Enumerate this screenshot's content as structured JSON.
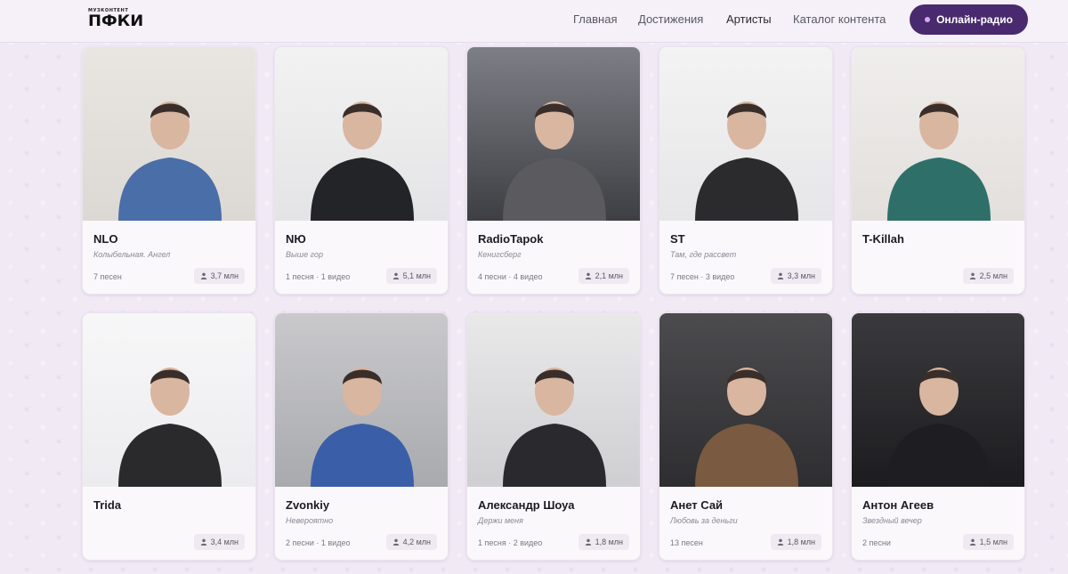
{
  "header": {
    "logo_small": "МУЗКОНТЕНТ",
    "logo_big": "ПФКИ",
    "nav": [
      {
        "label": "Главная"
      },
      {
        "label": "Достижения"
      },
      {
        "label": "Артисты"
      },
      {
        "label": "Каталог контента"
      }
    ],
    "radio_button": "Онлайн-радио"
  },
  "artists": [
    {
      "name": "NLO",
      "subtitle": "Колыбельная. Ангел",
      "meta": "7 песен",
      "listeners": "3,7 млн",
      "tone": "#4a6ea8"
    },
    {
      "name": "NЮ",
      "subtitle": "Выше гор",
      "meta": "1 песня · 1 видео",
      "listeners": "5,1 млн",
      "tone": "#232428"
    },
    {
      "name": "RadioTapok",
      "subtitle": "Кенигсберг",
      "meta": "4 песни · 4 видео",
      "listeners": "2,1 млн",
      "tone": "#5b5a5e"
    },
    {
      "name": "ST",
      "subtitle": "Там, где рассвет",
      "meta": "7 песен · 3 видео",
      "listeners": "3,3 млн",
      "tone": "#2b2b2e"
    },
    {
      "name": "T-Killah",
      "subtitle": "",
      "meta": "",
      "listeners": "2,5 млн",
      "tone": "#2f6f6a"
    },
    {
      "name": "Trida",
      "subtitle": "",
      "meta": "",
      "listeners": "3,4 млн",
      "tone": "#2a2a2d"
    },
    {
      "name": "Zvonkiy",
      "subtitle": "Невероятно",
      "meta": "2 песни · 1 видео",
      "listeners": "4,2 млн",
      "tone": "#3a5fa8"
    },
    {
      "name": "Александр Шоуа",
      "subtitle": "Держи меня",
      "meta": "1 песня · 2 видео",
      "listeners": "1,8 млн",
      "tone": "#2a2a2e"
    },
    {
      "name": "Анет Сай",
      "subtitle": "Любовь за деньги",
      "meta": "13 песен",
      "listeners": "1,8 млн",
      "tone": "#7a5a40"
    },
    {
      "name": "Антон Агеев",
      "subtitle": "Звездный вечер",
      "meta": "2 песни",
      "listeners": "1,5 млн",
      "tone": "#1e1e22"
    }
  ]
}
